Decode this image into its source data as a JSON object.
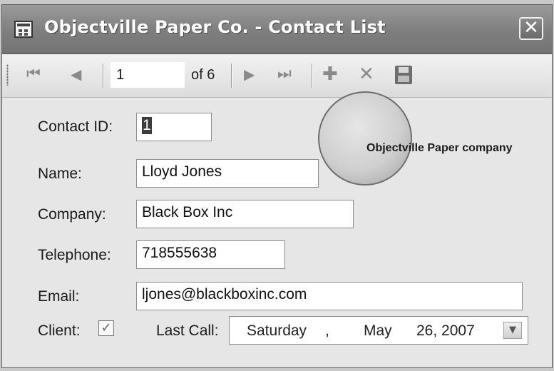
{
  "window": {
    "title": "Objectville Paper Co. - Contact List",
    "close_glyph": "✕"
  },
  "navigator": {
    "first_icon": "⏮",
    "prev_icon": "◀",
    "position": "1",
    "count_label": "of 6",
    "next_icon": "▶",
    "last_icon": "⏭",
    "add_icon": "✚",
    "delete_icon": "✕"
  },
  "form": {
    "contact_id": {
      "label": "Contact ID:",
      "value": "1"
    },
    "name": {
      "label": "Name:",
      "value": "Lloyd Jones"
    },
    "company": {
      "label": "Company:",
      "value": "Black Box Inc"
    },
    "telephone": {
      "label": "Telephone:",
      "value": "718555638"
    },
    "email": {
      "label": "Email:",
      "value": "ljones@blackboxinc.com"
    },
    "client": {
      "label": "Client:",
      "checked_glyph": "✓"
    },
    "last_call": {
      "label": "Last Call:",
      "weekday": "Saturday",
      "sep": ",",
      "month": "May",
      "day_year": "26, 2007",
      "dropdown_glyph": "▼"
    }
  },
  "logo": {
    "text": "Objectville Paper company"
  }
}
